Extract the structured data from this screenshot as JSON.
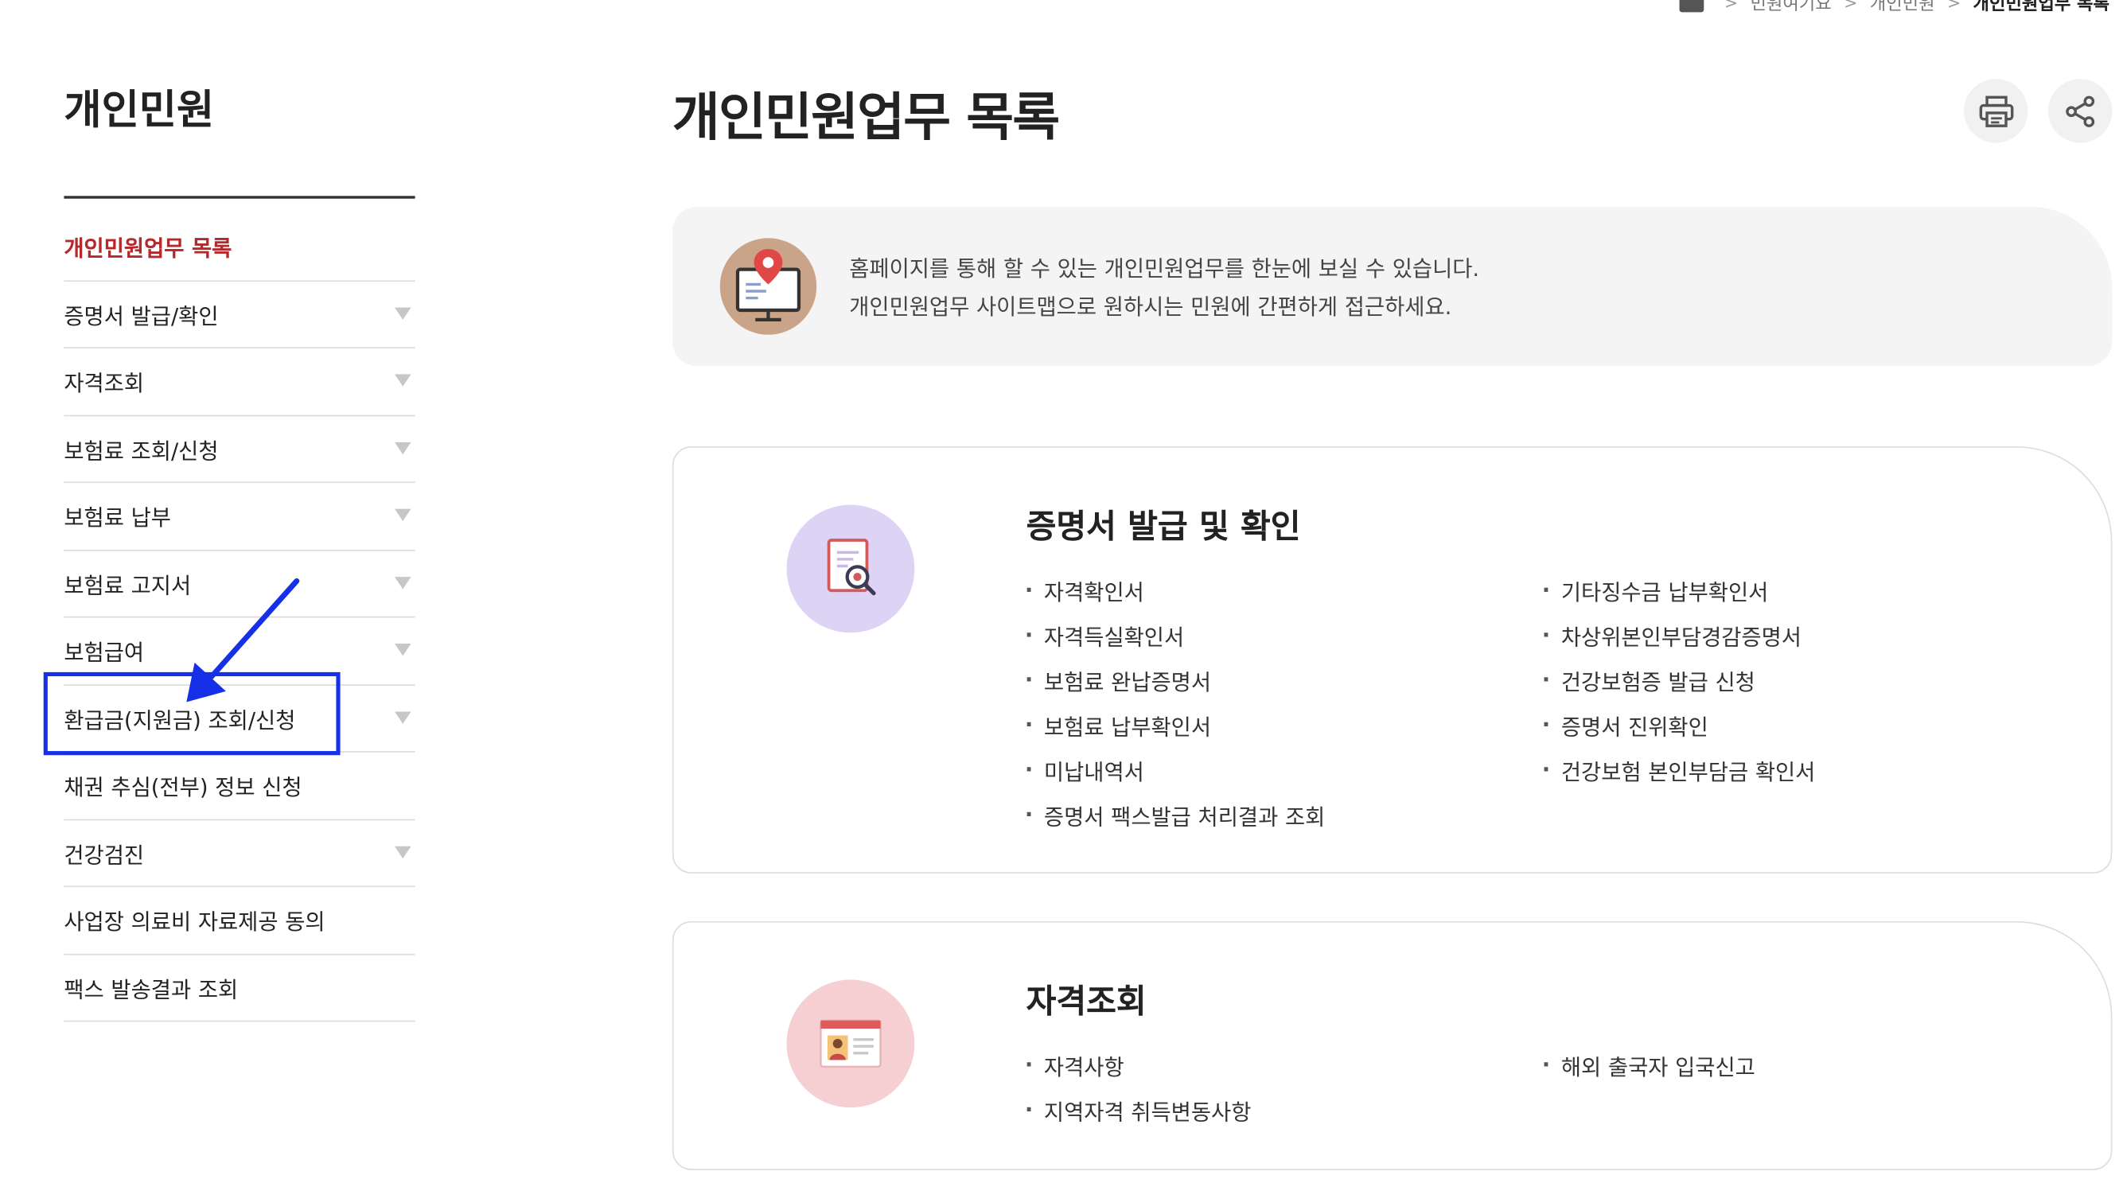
{
  "breadcrumb": {
    "items": [
      "민원여기요",
      "개인민원",
      "개인민원업무 목록"
    ]
  },
  "sidebar": {
    "title": "개인민원",
    "items": [
      {
        "label": "개인민원업무 목록",
        "active": true,
        "has_caret": false
      },
      {
        "label": "증명서 발급/확인",
        "active": false,
        "has_caret": true
      },
      {
        "label": "자격조회",
        "active": false,
        "has_caret": true
      },
      {
        "label": "보험료 조회/신청",
        "active": false,
        "has_caret": true
      },
      {
        "label": "보험료 납부",
        "active": false,
        "has_caret": true
      },
      {
        "label": "보험료 고지서",
        "active": false,
        "has_caret": true
      },
      {
        "label": "보험급여",
        "active": false,
        "has_caret": true
      },
      {
        "label": "환급금(지원금) 조회/신청",
        "active": false,
        "has_caret": true
      },
      {
        "label": "채권 추심(전부) 정보 신청",
        "active": false,
        "has_caret": false
      },
      {
        "label": "건강검진",
        "active": false,
        "has_caret": true
      },
      {
        "label": "사업장 의료비 자료제공 동의",
        "active": false,
        "has_caret": false
      },
      {
        "label": "팩스 발송결과 조회",
        "active": false,
        "has_caret": false
      }
    ]
  },
  "main": {
    "title": "개인민원업무 목록",
    "intro": {
      "line1": "홈페이지를 통해 할 수 있는 개인민원업무를 한눈에 보실 수 있습니다.",
      "line2": "개인민원업무 사이트맵으로 원하시는 민원에 간편하게 접근하세요."
    },
    "sections": [
      {
        "title": "증명서 발급 및 확인",
        "left": [
          "자격확인서",
          "자격득실확인서",
          "보험료 완납증명서",
          "보험료 납부확인서",
          "미납내역서",
          "증명서 팩스발급 처리결과 조회"
        ],
        "right": [
          "기타징수금 납부확인서",
          "차상위본인부담경감증명서",
          "건강보험증 발급 신청",
          "증명서 진위확인",
          "건강보험 본인부담금 확인서"
        ]
      },
      {
        "title": "자격조회",
        "left": [
          "자격사항",
          "지역자격 취득변동사항"
        ],
        "right": [
          "해외 출국자 입국신고"
        ]
      }
    ]
  },
  "colors": {
    "active_menu": "#b5282b",
    "annotation": "#1530e6",
    "card1_icon_bg": "#ddd3f4",
    "card2_icon_bg": "#f6cfd3",
    "intro_icon_bg": "#caa488"
  },
  "icons": {
    "breadcrumb_home": "home-icon",
    "print": "printer-icon",
    "share": "share-icon",
    "intro": "monitor-location-icon",
    "card1": "document-search-icon",
    "card2": "id-card-icon",
    "menu_caret": "caret-down-icon"
  }
}
